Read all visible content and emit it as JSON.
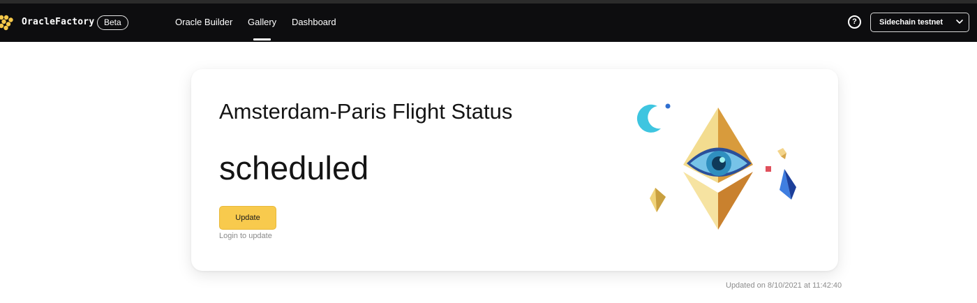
{
  "app": {
    "name": "OracleFactory",
    "badge": "Beta"
  },
  "nav": {
    "items": [
      {
        "label": "Oracle Builder",
        "active": false
      },
      {
        "label": "Gallery",
        "active": true
      },
      {
        "label": "Dashboard",
        "active": false
      }
    ],
    "help_icon": "question-circle-icon",
    "network_select": {
      "value": "Sidechain testnet"
    }
  },
  "card": {
    "title": "Amsterdam-Paris Flight Status",
    "status": "scheduled",
    "update_label": "Update",
    "login_note": "Login to update",
    "illustration": "ethereum-eye-illustration"
  },
  "footer": {
    "updated": "Updated on 8/10/2021 at 11:42:40"
  },
  "colors": {
    "navbar": "#0d0d0f",
    "accent": "#f8ca4d",
    "text": "#141414"
  }
}
